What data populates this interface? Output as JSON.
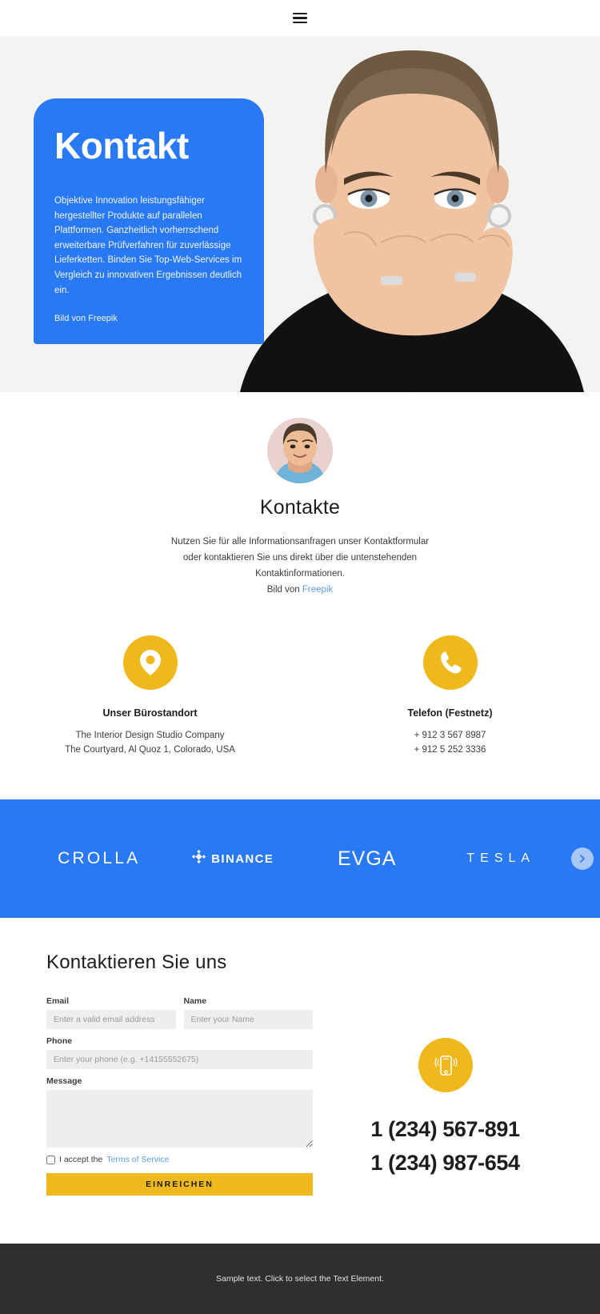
{
  "topbar": {
    "menu_icon": "hamburger-menu-icon"
  },
  "hero": {
    "title": "Kontakt",
    "body": "Objektive Innovation leistungsfähiger hergestellter Produkte auf parallelen Plattformen. Ganzheitlich vorherrschend erweiterbare Prüfverfahren für zuverlässige Lieferketten. Binden Sie Top-Web-Services im Vergleich zu innovativen Ergebnissen deutlich ein.",
    "credit": "Bild von Freepik",
    "card_color": "#2979f5",
    "image_alt": "portrait-photo"
  },
  "contacts": {
    "avatar": "person-avatar",
    "heading": "Kontakte",
    "description": "Nutzen Sie für alle Informationsanfragen unser Kontaktformular oder kontaktieren Sie uns direkt über die untenstehenden Kontaktinformationen.",
    "credit_prefix": "Bild von ",
    "credit_link": "Freepik",
    "link_color": "#5b9bf0"
  },
  "info": {
    "accent_color": "#efb81c",
    "items": [
      {
        "icon": "location-pin-icon",
        "title": "Unser Bürostandort",
        "line1": "The Interior Design Studio Company",
        "line2": "The Courtyard, Al Quoz 1, Colorado, USA"
      },
      {
        "icon": "phone-handset-icon",
        "title": "Telefon (Festnetz)",
        "line1": "+ 912 3 567 8987",
        "line2": "+ 912 5 252 3336"
      }
    ]
  },
  "logoband": {
    "background": "#2979f5",
    "logos": [
      {
        "name": "CROLLA",
        "icon": ""
      },
      {
        "name": "BINANCE",
        "icon": "binance-diamond-icon"
      },
      {
        "name": "EVGA",
        "icon": ""
      },
      {
        "name": "TESLA",
        "icon": ""
      }
    ],
    "next_icon": "chevron-right-icon"
  },
  "form": {
    "heading": "Kontaktieren Sie uns",
    "email_label": "Email",
    "email_placeholder": "Enter a valid email address",
    "email_value": "",
    "name_label": "Name",
    "name_placeholder": "Enter your Name",
    "name_value": "",
    "phone_label": "Phone",
    "phone_placeholder": "Enter your phone (e.g. +14155552675)",
    "phone_value": "",
    "message_label": "Message",
    "message_placeholder": "",
    "message_value": "",
    "terms_prefix": "I accept the ",
    "terms_link": "Terms of Service",
    "submit_label": "EINREICHEN",
    "submit_color": "#efb81c"
  },
  "phone_block": {
    "icon": "mobile-phone-icon",
    "number1": "1 (234) 567-891",
    "number2": "1 (234) 987-654"
  },
  "footer": {
    "text": "Sample text. Click to select the Text Element.",
    "background": "#2f2f2f"
  }
}
